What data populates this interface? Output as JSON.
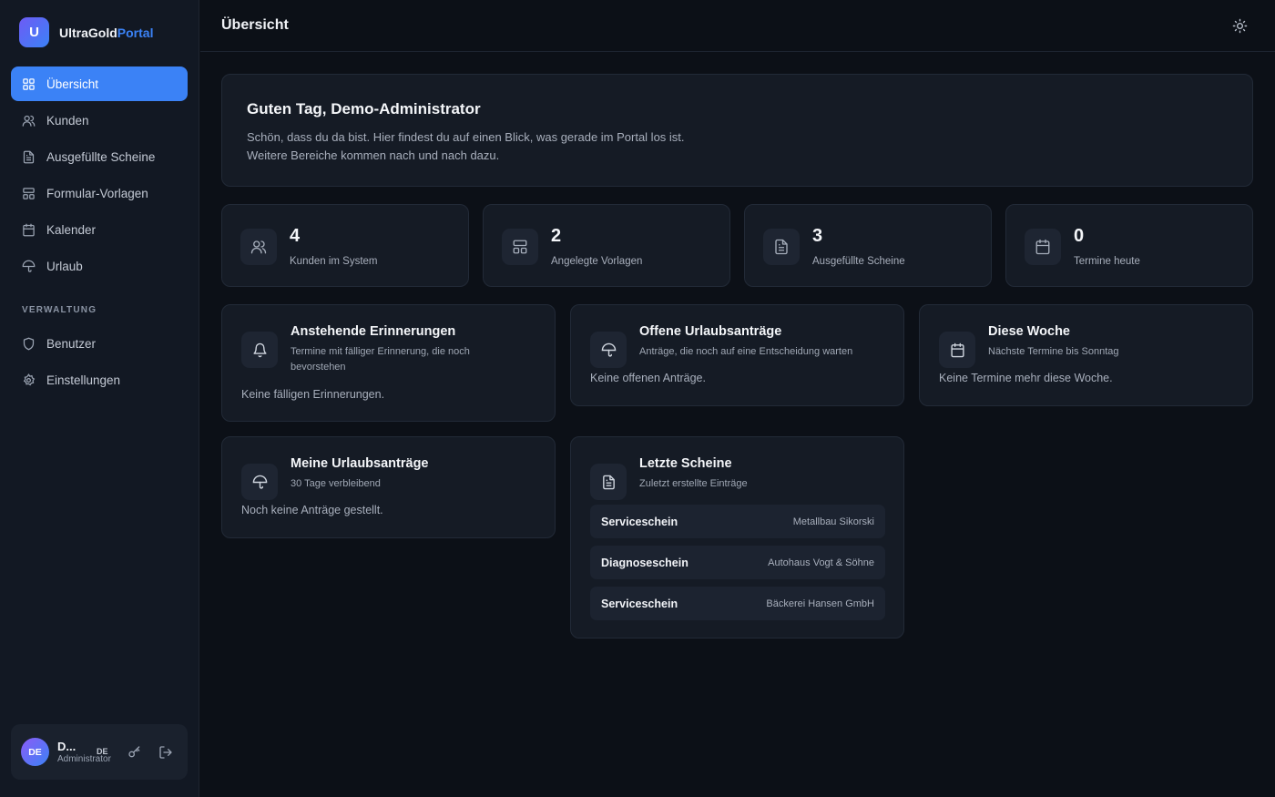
{
  "brand": {
    "logo_letter": "U",
    "name_main": "UltraGold",
    "name_accent": "Portal"
  },
  "sidebar": {
    "items": [
      {
        "label": "Übersicht",
        "icon": "grid-icon",
        "active": true
      },
      {
        "label": "Kunden",
        "icon": "users-icon"
      },
      {
        "label": "Ausgefüllte Scheine",
        "icon": "document-icon"
      },
      {
        "label": "Formular-Vorlagen",
        "icon": "template-icon"
      },
      {
        "label": "Kalender",
        "icon": "calendar-icon"
      },
      {
        "label": "Urlaub",
        "icon": "umbrella-icon"
      }
    ],
    "section_label": "VERWALTUNG",
    "admin_items": [
      {
        "label": "Benutzer",
        "icon": "shield-icon"
      },
      {
        "label": "Einstellungen",
        "icon": "gear-icon"
      }
    ]
  },
  "user": {
    "initials": "DE",
    "name": "D...",
    "role": "Administrator",
    "language": "DE"
  },
  "header": {
    "title": "Übersicht",
    "theme_icon": "sun-icon"
  },
  "welcome": {
    "title": "Guten Tag, Demo-Administrator",
    "line1": "Schön, dass du da bist. Hier findest du auf einen Blick, was gerade im Portal los ist.",
    "line2": "Weitere Bereiche kommen nach und nach dazu."
  },
  "stats": [
    {
      "value": "4",
      "label": "Kunden im System",
      "icon": "users-icon"
    },
    {
      "value": "2",
      "label": "Angelegte Vorlagen",
      "icon": "template-icon"
    },
    {
      "value": "3",
      "label": "Ausgefüllte Scheine",
      "icon": "document-icon"
    },
    {
      "value": "0",
      "label": "Termine heute",
      "icon": "calendar-icon"
    }
  ],
  "reminders": {
    "title": "Anstehende Erinnerungen",
    "subtitle": "Termine mit fälliger Erinnerung, die noch bevorstehen",
    "empty": "Keine fälligen Erinnerungen."
  },
  "open_requests": {
    "title": "Offene Urlaubsanträge",
    "subtitle": "Anträge, die noch auf eine Entscheidung warten",
    "empty": "Keine offenen Anträge."
  },
  "this_week": {
    "title": "Diese Woche",
    "subtitle": "Nächste Termine bis Sonntag",
    "empty": "Keine Termine mehr diese Woche."
  },
  "my_requests": {
    "title": "Meine Urlaubsanträge",
    "subtitle": "30 Tage verbleibend",
    "empty": "Noch keine Anträge gestellt."
  },
  "recent_slips": {
    "title": "Letzte Scheine",
    "subtitle": "Zuletzt erstellte Einträge",
    "items": [
      {
        "type": "Serviceschein",
        "customer": "Metallbau Sikorski"
      },
      {
        "type": "Diagnoseschein",
        "customer": "Autohaus Vogt & Söhne"
      },
      {
        "type": "Serviceschein",
        "customer": "Bäckerei Hansen GmbH"
      }
    ]
  }
}
